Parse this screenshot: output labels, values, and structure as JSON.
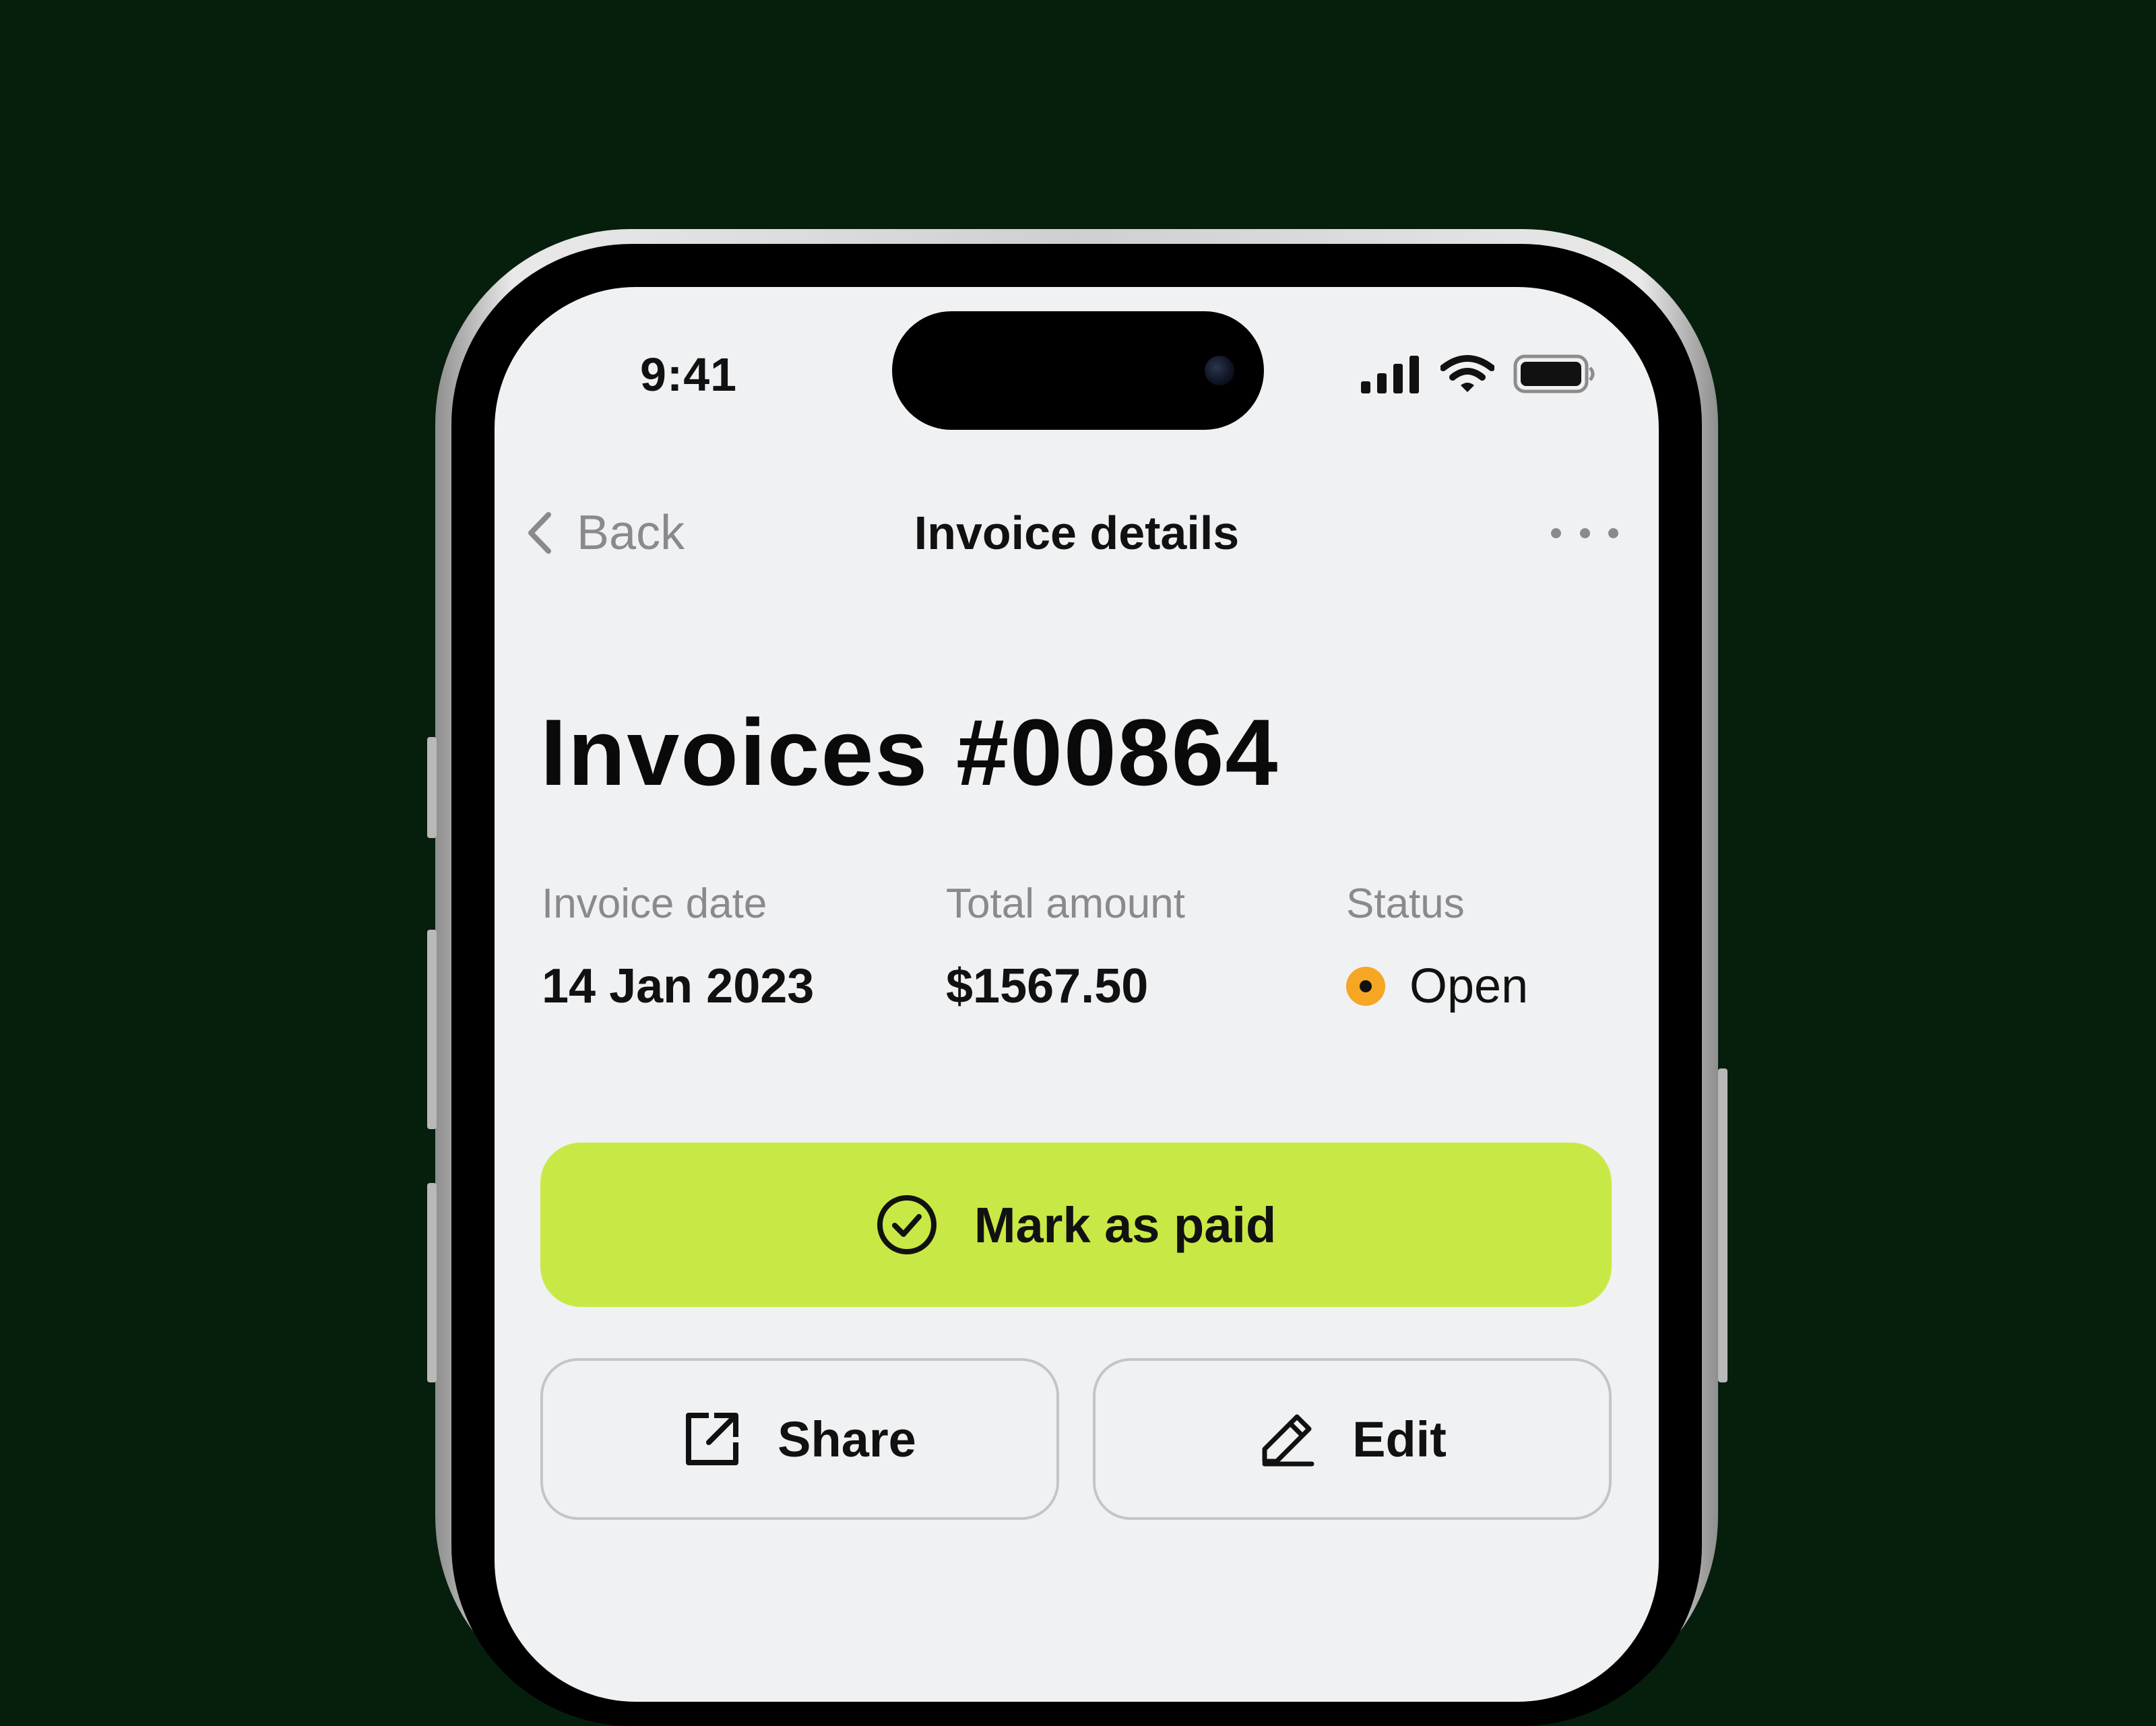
{
  "status_bar": {
    "time": "9:41",
    "icons": [
      "cellular-signal-icon",
      "wifi-icon",
      "battery-icon"
    ]
  },
  "nav": {
    "back_label": "Back",
    "title": "Invoice details",
    "more_icon": "more-horizontal-icon"
  },
  "invoice": {
    "title": "Invoices #00864",
    "date_label": "Invoice date",
    "date_value": "14 Jan 2023",
    "amount_label": "Total amount",
    "amount_value": "$1567.50",
    "status_label": "Status",
    "status_value": "Open",
    "status_color": "#f5a623"
  },
  "actions": {
    "mark_paid_label": "Mark as paid",
    "mark_paid_icon": "check-circle-icon",
    "share_label": "Share",
    "share_icon": "share-external-icon",
    "edit_label": "Edit",
    "edit_icon": "pencil-icon"
  },
  "colors": {
    "background": "#061f0c",
    "primary_button": "#c8e945",
    "screen": "#f0f1f3"
  }
}
